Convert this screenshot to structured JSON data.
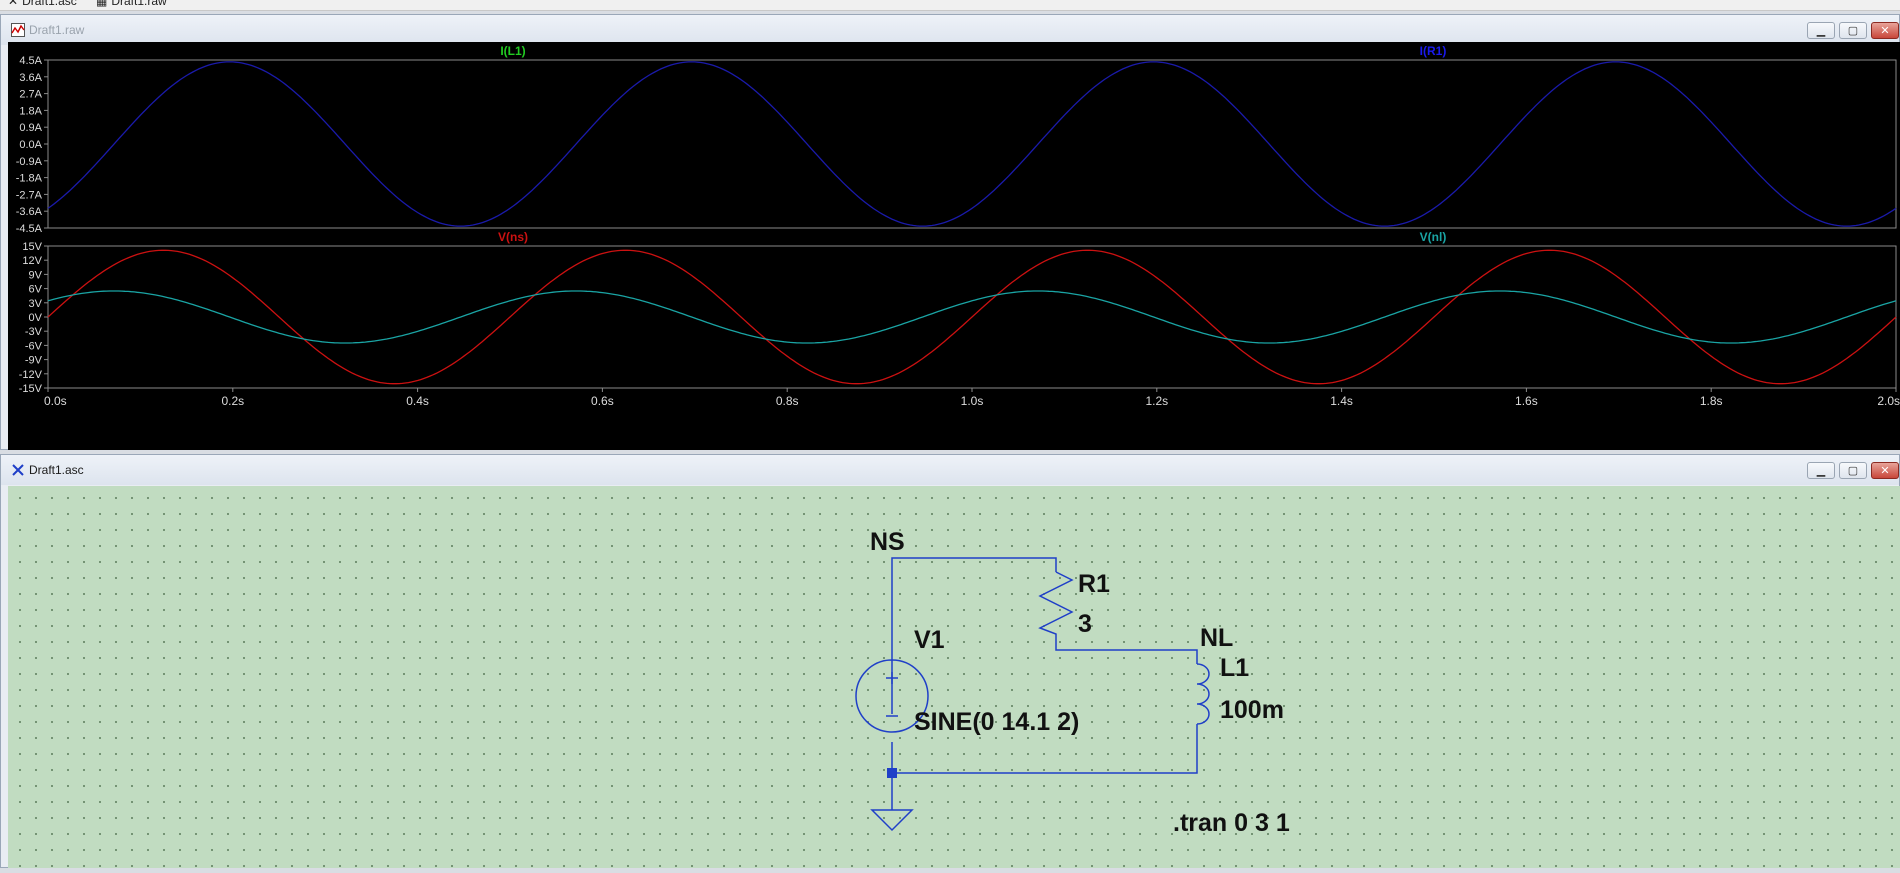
{
  "top_tabs": [
    {
      "label": "Draft1.asc",
      "icon": "schematic-icon"
    },
    {
      "label": "Draft1.raw",
      "icon": "waveform-icon"
    }
  ],
  "waveform_window": {
    "title": "Draft1.raw",
    "buttons": {
      "minimize": "▁",
      "maximize": "▢",
      "close": "✕"
    }
  },
  "schematic_window": {
    "title": "Draft1.asc",
    "buttons": {
      "minimize": "▁",
      "maximize": "▢",
      "close": "✕"
    }
  },
  "colors": {
    "plot_bg": "#000000",
    "axis": "#8a8a8a",
    "trace_current": "#1a1aaa",
    "trace_vns": "#cc1111",
    "trace_vnl": "#1aa4a4",
    "label_il1": "#22cc22",
    "label_ir1": "#1a1aee",
    "wire": "#1f3fc8",
    "component": "#1f3fc8",
    "schematic_bg": "#c1dcc1"
  },
  "chart_data": [
    {
      "type": "line",
      "pane": "top",
      "trace_labels": [
        "I(L1)",
        "I(R1)"
      ],
      "ylim": [
        -4.5,
        4.5
      ],
      "yticks": [
        "4.5A",
        "3.6A",
        "2.7A",
        "1.8A",
        "0.9A",
        "0.0A",
        "-0.9A",
        "-1.8A",
        "-2.7A",
        "-3.6A",
        "-4.5A"
      ],
      "xlim": [
        0,
        2.0
      ],
      "series": [
        {
          "name": "I(L1)",
          "amplitude": 4.4,
          "frequency": 2,
          "phase_deg": -51.5
        }
      ]
    },
    {
      "type": "line",
      "pane": "bottom",
      "trace_labels": [
        "V(ns)",
        "V(nl)"
      ],
      "ylim": [
        -15,
        15
      ],
      "yticks": [
        "15V",
        "12V",
        "9V",
        "6V",
        "3V",
        "0V",
        "-3V",
        "-6V",
        "-9V",
        "-12V",
        "-15V"
      ],
      "xlim": [
        0,
        2.0
      ],
      "xticks": [
        "0.0s",
        "0.2s",
        "0.4s",
        "0.6s",
        "0.8s",
        "1.0s",
        "1.2s",
        "1.4s",
        "1.6s",
        "1.8s",
        "2.0s"
      ],
      "series": [
        {
          "name": "V(ns)",
          "amplitude": 14.1,
          "frequency": 2,
          "phase_deg": 0
        },
        {
          "name": "V(nl)",
          "amplitude": 5.5,
          "frequency": 2,
          "phase_deg": 38.5
        }
      ]
    }
  ],
  "schematic": {
    "net_ns": "NS",
    "net_nl": "NL",
    "r1_name": "R1",
    "r1_value": "3",
    "v1_name": "V1",
    "v1_value": "SINE(0 14.1 2)",
    "l1_name": "L1",
    "l1_value": "100m",
    "directive": ".tran 0 3 1"
  }
}
